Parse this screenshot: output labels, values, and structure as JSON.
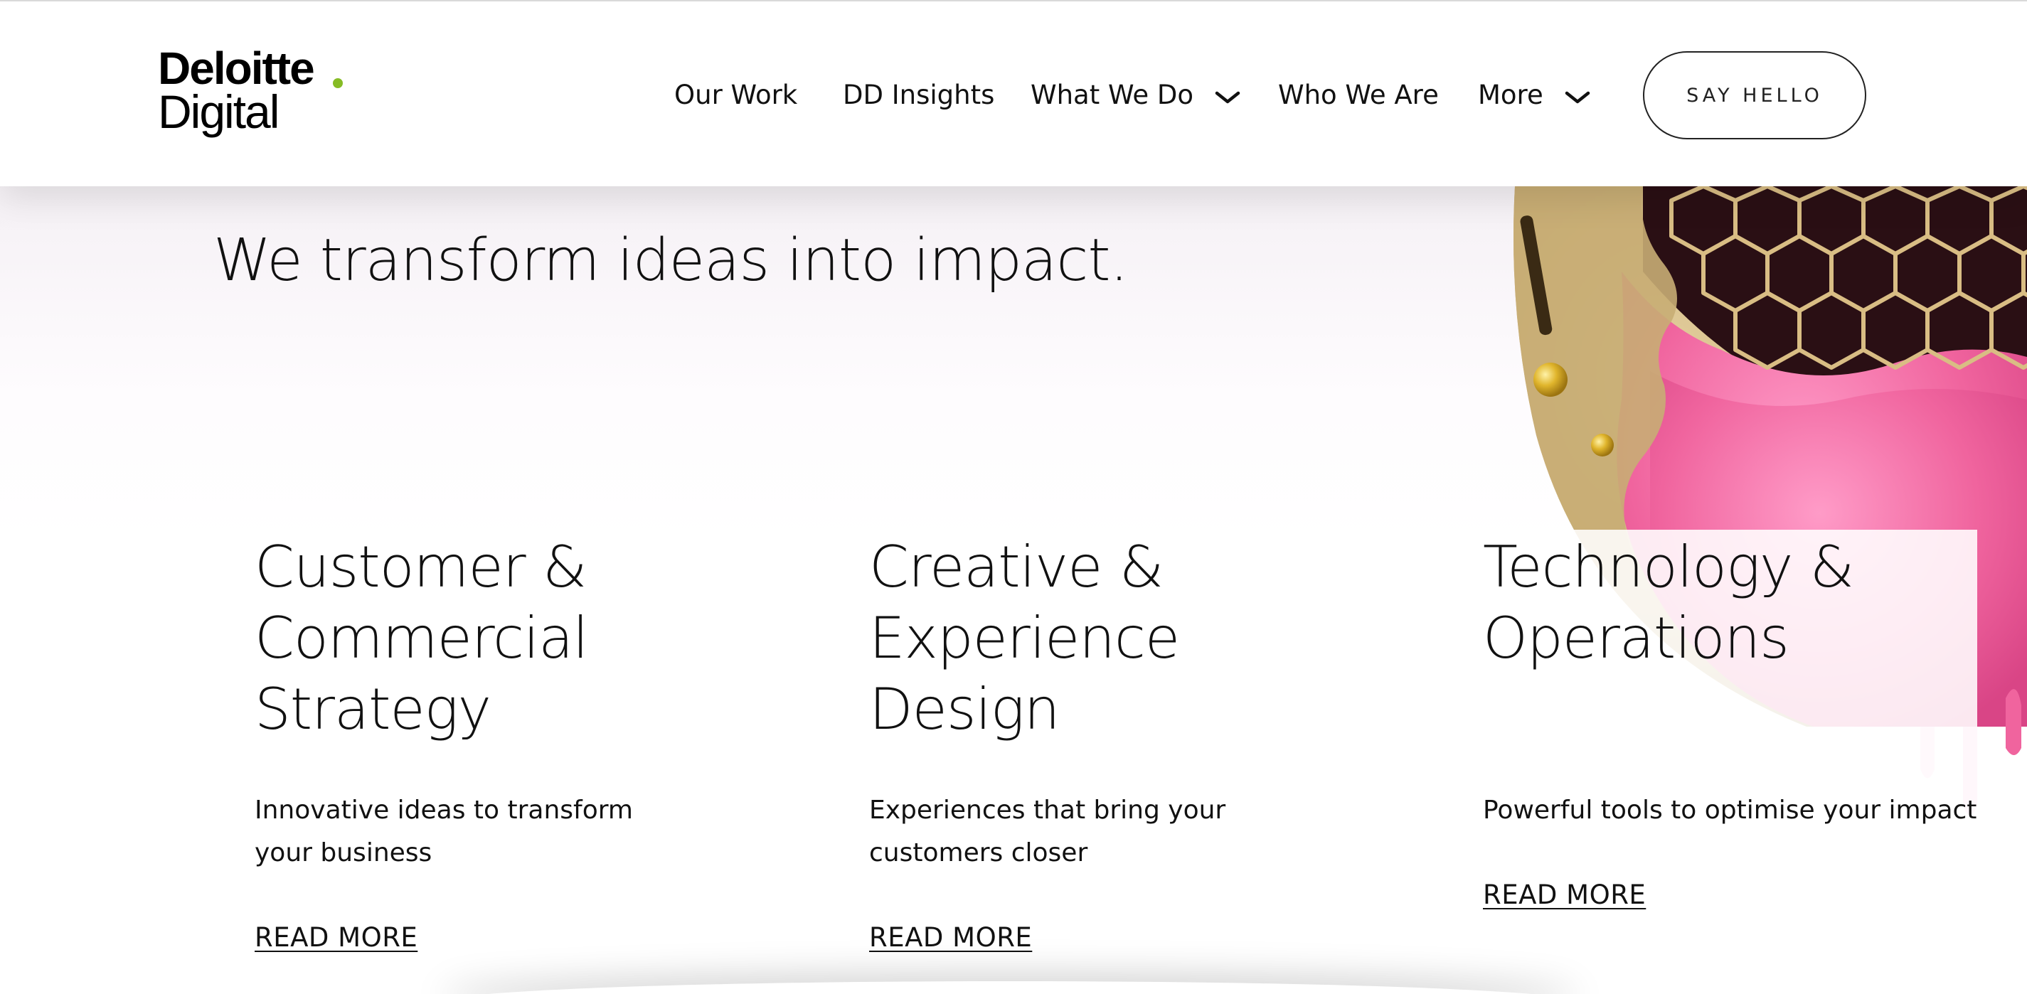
{
  "brand": {
    "name": "Deloitte",
    "sub": "Digital",
    "dot_color": "#86bc25"
  },
  "nav": {
    "items": [
      {
        "label": "Our Work",
        "has_dropdown": false
      },
      {
        "label": "DD Insights",
        "has_dropdown": false
      },
      {
        "label": "What We Do",
        "has_dropdown": true,
        "icon": "chevron-down-icon"
      },
      {
        "label": "Who We Are",
        "has_dropdown": false
      },
      {
        "label": "More",
        "has_dropdown": true,
        "icon": "chevron-down-icon"
      }
    ],
    "cta_label": "SAY HELLO"
  },
  "hero": {
    "title": "We transform ideas into impact.",
    "art": "gold-sphere-with-pink-paint-honeycomb"
  },
  "cards": [
    {
      "title": "Customer & Commercial Strategy",
      "description": "Innovative ideas to transform your business",
      "link": "READ MORE"
    },
    {
      "title": "Creative & Experience Design",
      "description": "Experiences that bring your customers closer",
      "link": "READ MORE"
    },
    {
      "title": "Technology & Operations",
      "description": "Powerful tools to optimise your impact",
      "link": "READ MORE"
    }
  ],
  "colors": {
    "accent_pink": "#f0649e",
    "gold": "#c9b07a",
    "text": "#111111"
  }
}
